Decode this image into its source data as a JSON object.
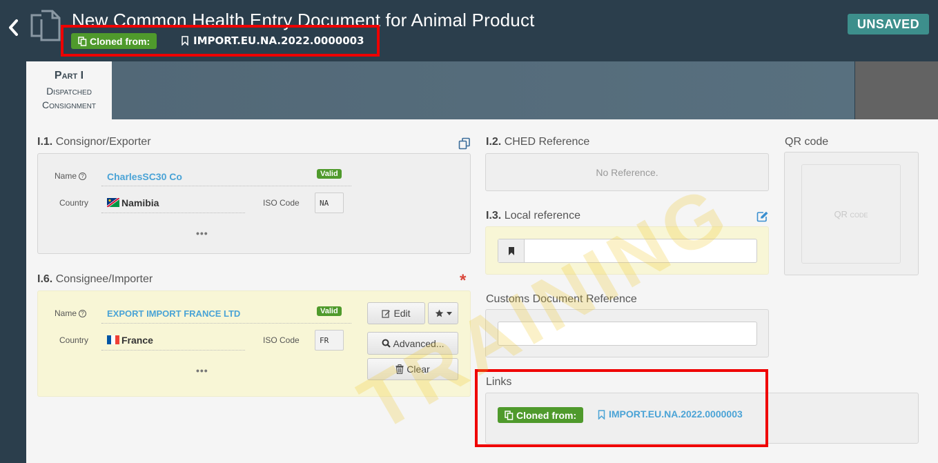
{
  "header": {
    "title": "New Common Health Entry Document for Animal Product",
    "cloned_label": "Cloned from:",
    "cloned_reference": "IMPORT.EU.NA.2022.0000003",
    "status": "UNSAVED"
  },
  "tabs": [
    {
      "line1": "Part I",
      "line2": "Dispatched",
      "line3": "Consignment"
    }
  ],
  "consignor": {
    "number": "I.1.",
    "title": "Consignor/Exporter",
    "name_label": "Name",
    "name_value": "CharlesSC30 Co",
    "valid_badge": "Valid",
    "country_label": "Country",
    "country_value": "Namibia",
    "iso_label": "ISO Code",
    "iso_value": "NA",
    "more": "•••"
  },
  "consignee": {
    "number": "I.6.",
    "title": "Consignee/Importer",
    "required_mark": "*",
    "name_label": "Name",
    "name_value": "EXPORT IMPORT FRANCE LTD",
    "valid_badge": "Valid",
    "country_label": "Country",
    "country_value": "France",
    "iso_label": "ISO Code",
    "iso_value": "FR",
    "more": "•••",
    "edit_label": "Edit",
    "advanced_label": "Advanced...",
    "clear_label": "Clear"
  },
  "ched_reference": {
    "number": "I.2.",
    "title": "CHED Reference",
    "value": "No Reference."
  },
  "local_reference": {
    "number": "I.3.",
    "title": "Local reference",
    "value": ""
  },
  "customs": {
    "title": "Customs Document Reference",
    "value": ""
  },
  "qr": {
    "title": "QR code",
    "placeholder": "QR code"
  },
  "links": {
    "title": "Links",
    "cloned_label": "Cloned from:",
    "cloned_reference": "IMPORT.EU.NA.2022.0000003"
  },
  "watermark": "TRAINING",
  "colors": {
    "background": "#2b3e4c",
    "badge_green": "#4f9a2c",
    "unsaved": "#3d8f8c",
    "link_blue": "#4aa3d6",
    "highlight_red": "#ef0000",
    "well_yellow": "#f8f6d6"
  },
  "icons": [
    "chevron-left-icon",
    "documents-icon",
    "copy-icon",
    "bookmark-icon",
    "edit-icon",
    "pencil-square-icon",
    "search-icon",
    "trash-icon",
    "star-icon",
    "caret-down-icon",
    "help-icon",
    "flag-namibia-icon",
    "flag-france-icon"
  ]
}
